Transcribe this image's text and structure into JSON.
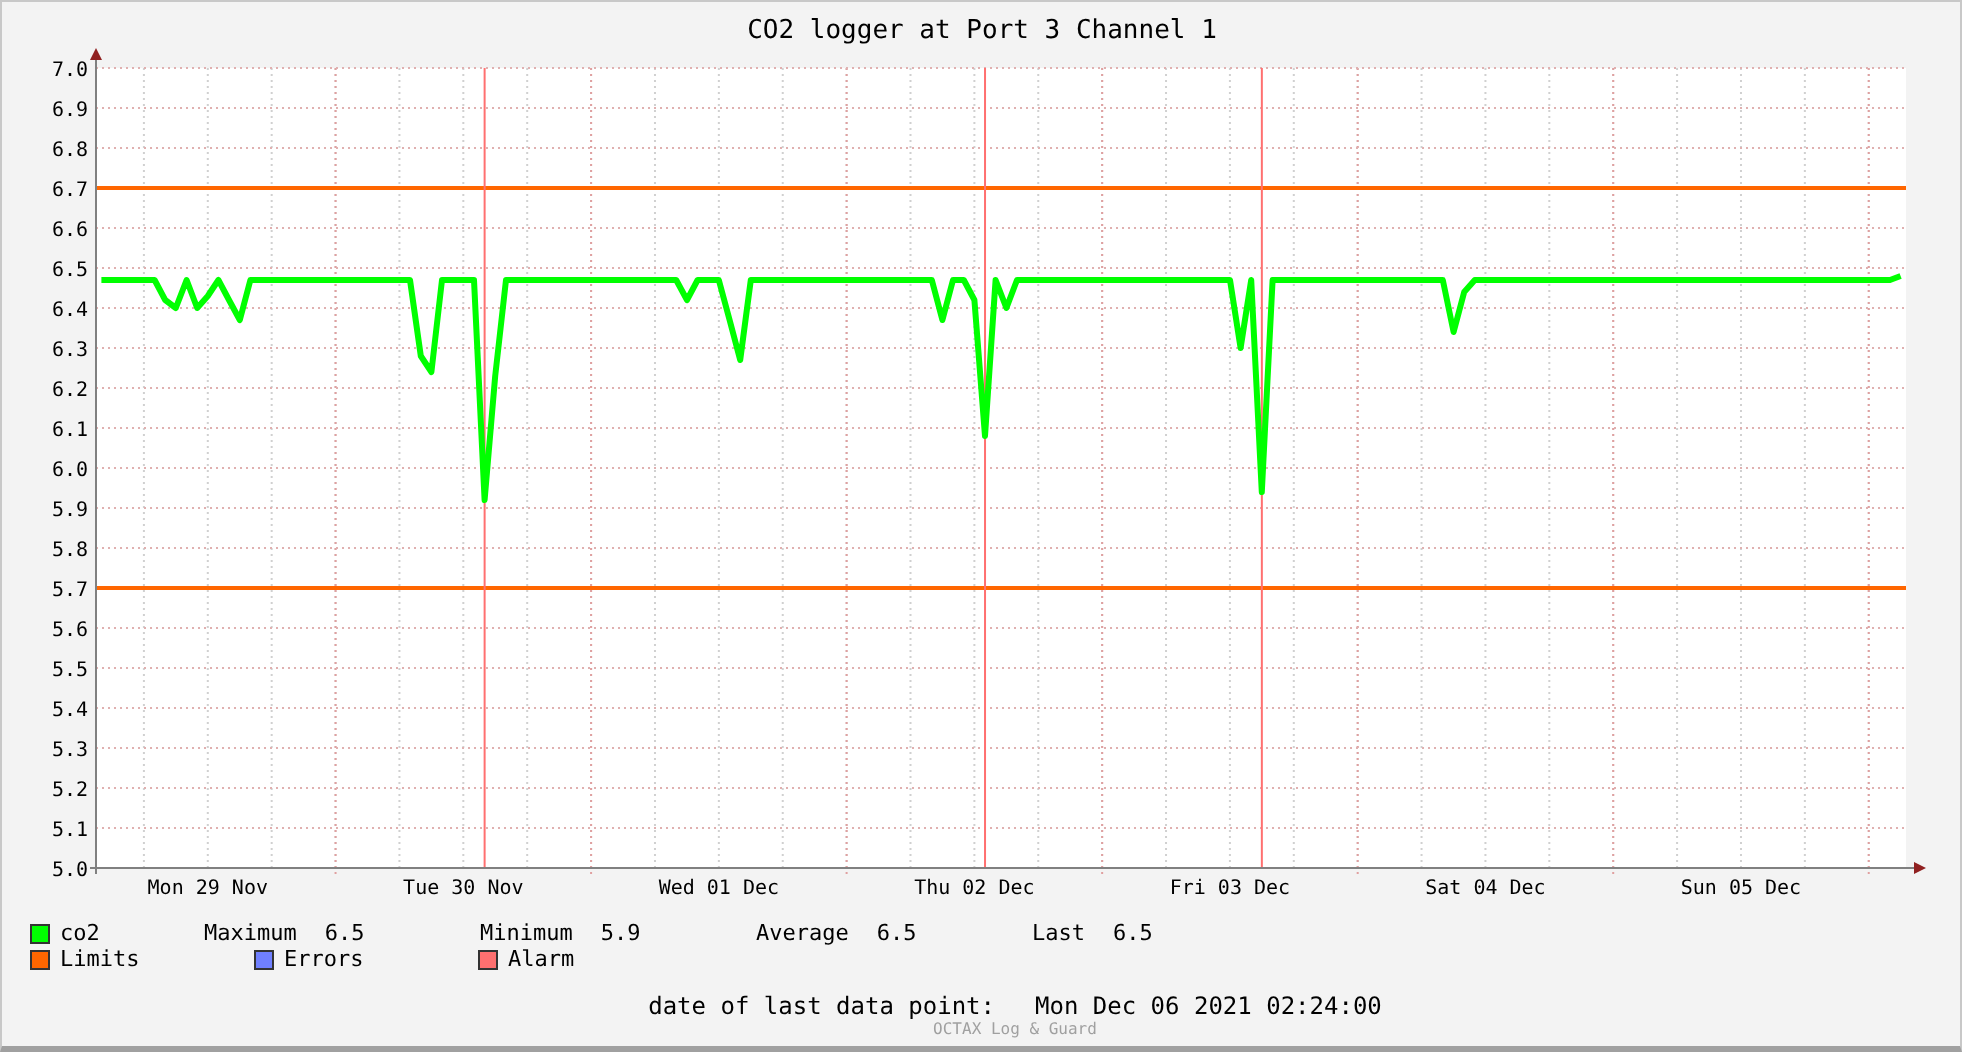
{
  "chart_data": {
    "type": "line",
    "title": "CO2 logger at Port 3 Channel 1",
    "categories": [
      null,
      null,
      null,
      null,
      null,
      null,
      null,
      null,
      null,
      null,
      "Mon 29 Nov",
      null,
      null,
      null,
      null,
      null,
      null,
      null,
      null,
      null,
      null,
      null,
      null,
      null,
      null,
      null,
      null,
      null,
      null,
      null,
      null,
      null,
      null,
      null,
      "Tue 30 Nov",
      null,
      null,
      null,
      null,
      null,
      null,
      null,
      null,
      null,
      null,
      null,
      null,
      null,
      null,
      null,
      null,
      null,
      null,
      null,
      null,
      null,
      null,
      null,
      "Wed 01 Dec",
      null,
      null,
      null,
      null,
      null,
      null,
      null,
      null,
      null,
      null,
      null,
      null,
      null,
      null,
      null,
      null,
      null,
      null,
      null,
      null,
      null,
      null,
      null,
      "Thu 02 Dec",
      null,
      null,
      null,
      null,
      null,
      null,
      null,
      null,
      null,
      null,
      null,
      null,
      null,
      null,
      null,
      null,
      null,
      null,
      null,
      null,
      null,
      null,
      null,
      "Fri 03 Dec",
      null,
      null,
      null,
      null,
      null,
      null,
      null,
      null,
      null,
      null,
      null,
      null,
      null,
      null,
      null,
      null,
      null,
      null,
      null,
      null,
      null,
      null,
      null,
      "Sat 04 Dec",
      null,
      null,
      null,
      null,
      null,
      null,
      null,
      null,
      null,
      null,
      null,
      null,
      null,
      null,
      null,
      null,
      null,
      null,
      null,
      null,
      null,
      null,
      null,
      "Sun 05 Dec",
      null,
      null,
      null,
      null,
      null,
      null,
      null,
      null,
      null,
      null,
      null,
      null,
      null,
      null,
      null
    ],
    "series": [
      {
        "name": "co2",
        "color": "#00ff00",
        "values": [
          6.47,
          6.47,
          6.47,
          6.47,
          6.47,
          6.47,
          6.42,
          6.4,
          6.47,
          6.4,
          6.43,
          6.47,
          6.42,
          6.37,
          6.47,
          6.47,
          6.47,
          6.47,
          6.47,
          6.47,
          6.47,
          6.47,
          6.47,
          6.47,
          6.47,
          6.47,
          6.47,
          6.47,
          6.47,
          6.47,
          6.28,
          6.24,
          6.47,
          6.47,
          6.47,
          6.47,
          5.92,
          6.23,
          6.47,
          6.47,
          6.47,
          6.47,
          6.47,
          6.47,
          6.47,
          6.47,
          6.47,
          6.47,
          6.47,
          6.47,
          6.47,
          6.47,
          6.47,
          6.47,
          6.47,
          6.42,
          6.47,
          6.47,
          6.47,
          6.37,
          6.27,
          6.47,
          6.47,
          6.47,
          6.47,
          6.47,
          6.47,
          6.47,
          6.47,
          6.47,
          6.47,
          6.47,
          6.47,
          6.47,
          6.47,
          6.47,
          6.47,
          6.47,
          6.47,
          6.37,
          6.47,
          6.47,
          6.42,
          6.08,
          6.47,
          6.4,
          6.47,
          6.47,
          6.47,
          6.47,
          6.47,
          6.47,
          6.47,
          6.47,
          6.47,
          6.47,
          6.47,
          6.47,
          6.47,
          6.47,
          6.47,
          6.47,
          6.47,
          6.47,
          6.47,
          6.47,
          6.47,
          6.3,
          6.47,
          5.94,
          6.47,
          6.47,
          6.47,
          6.47,
          6.47,
          6.47,
          6.47,
          6.47,
          6.47,
          6.47,
          6.47,
          6.47,
          6.47,
          6.47,
          6.47,
          6.47,
          6.47,
          6.34,
          6.44,
          6.47,
          6.47,
          6.47,
          6.47,
          6.47,
          6.47,
          6.47,
          6.47,
          6.47,
          6.47,
          6.47,
          6.47,
          6.47,
          6.47,
          6.47,
          6.47,
          6.47,
          6.47,
          6.47,
          6.47,
          6.47,
          6.47,
          6.47,
          6.47,
          6.47,
          6.47,
          6.47,
          6.47,
          6.47,
          6.47,
          6.47,
          6.47,
          6.47,
          6.47,
          6.47,
          6.47,
          6.47,
          6.47,
          6.47,
          6.47,
          6.48
        ]
      }
    ],
    "ylim": [
      5.0,
      7.0
    ],
    "yticks": [
      {
        "value": 5.0,
        "label": "5.0"
      },
      {
        "value": 5.1,
        "label": "5.1"
      },
      {
        "value": 5.2,
        "label": "5.2"
      },
      {
        "value": 5.3,
        "label": "5.3"
      },
      {
        "value": 5.4,
        "label": "5.4"
      },
      {
        "value": 5.5,
        "label": "5.5"
      },
      {
        "value": 5.6,
        "label": "5.6"
      },
      {
        "value": 5.7,
        "label": "5.7"
      },
      {
        "value": 5.8,
        "label": "5.8"
      },
      {
        "value": 5.9,
        "label": "5.9"
      },
      {
        "value": 6.0,
        "label": "6.0"
      },
      {
        "value": 6.1,
        "label": "6.1"
      },
      {
        "value": 6.2,
        "label": "6.2"
      },
      {
        "value": 6.3,
        "label": "6.3"
      },
      {
        "value": 6.4,
        "label": "6.4"
      },
      {
        "value": 6.5,
        "label": "6.5"
      },
      {
        "value": 6.6,
        "label": "6.6"
      },
      {
        "value": 6.7,
        "label": "6.7"
      },
      {
        "value": 6.8,
        "label": "6.8"
      },
      {
        "value": 6.9,
        "label": "6.9"
      },
      {
        "value": 7.0,
        "label": "7.0"
      }
    ],
    "grid": true
  },
  "legend": [
    {
      "color": "#00ff00",
      "stats": [
        {
          "label": "Maximum",
          "value": "6.5"
        },
        {
          "label": "Minimum",
          "value": "5.9"
        },
        {
          "label": "Average",
          "value": "6.5"
        },
        {
          "label": "Last",
          "value": "6.5"
        }
      ]
    },
    {
      "label": "Limits",
      "color": "#ff6600"
    },
    {
      "label": "Errors",
      "color": "#7080ff"
    },
    {
      "label": "Alarm",
      "color": "#ff7070"
    }
  ],
  "last_data_point": {
    "label": "date of last data point:",
    "value": "Mon Dec 06 2021 02:24:00"
  },
  "credit": "OCTAX Log & Guard"
}
